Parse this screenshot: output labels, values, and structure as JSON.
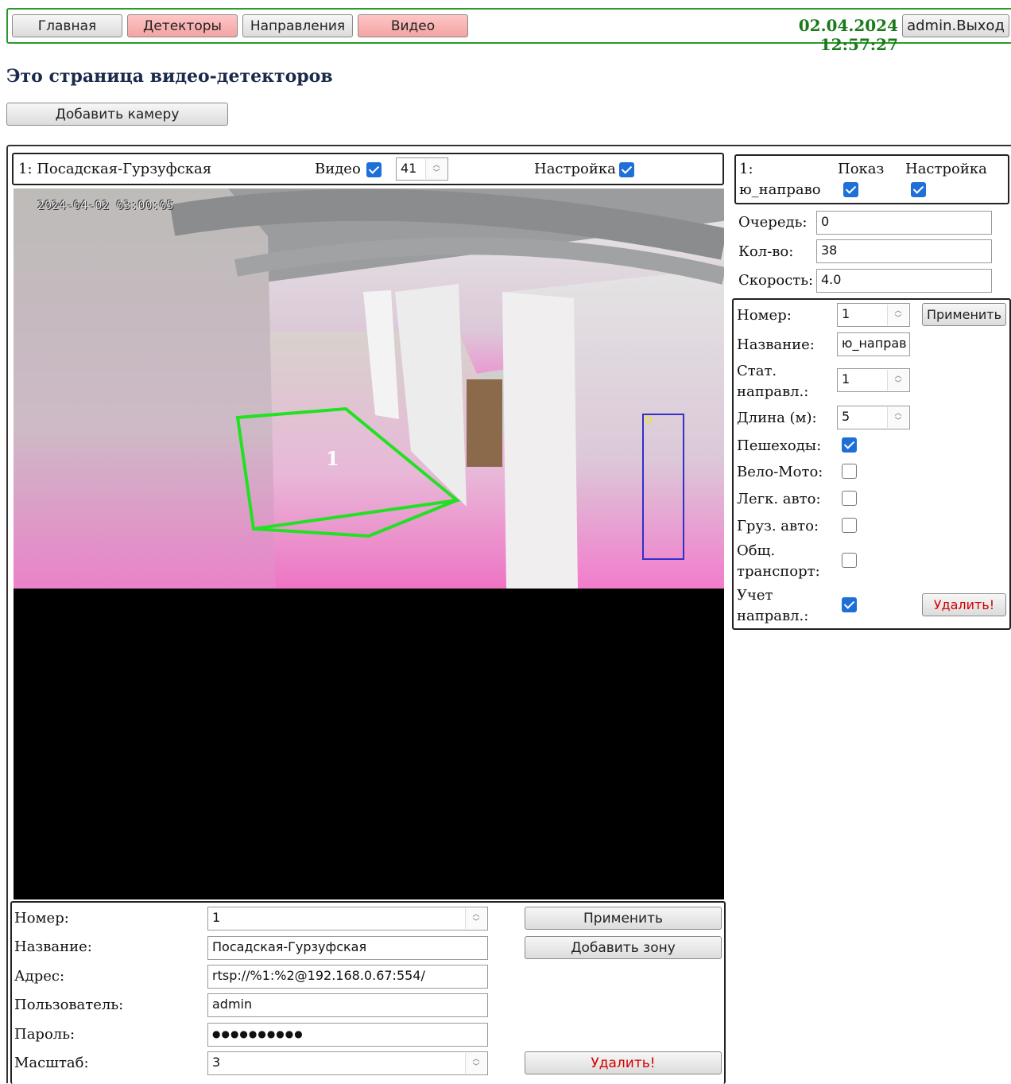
{
  "nav": {
    "home": "Главная",
    "detectors": "Детекторы",
    "directions": "Направления",
    "video": "Видео",
    "datetime": "02.04.2024 12:57:27",
    "logout": "admin.Выход"
  },
  "page_title": "Это страница видео-детекторов",
  "add_camera": "Добавить камеру",
  "camera_header": {
    "name": "1: Посадская-Гурзуфская",
    "video_label": "Видео",
    "video_checked": true,
    "fps_value": "41",
    "settings_label": "Настройка",
    "settings_checked": true
  },
  "video": {
    "timestamp": "2024-04-02 03:00:05",
    "zone_label": "1",
    "detection_label": "0",
    "zone_color": "#22e022",
    "box_color": "#3030c8"
  },
  "camera_form": {
    "number_label": "Номер:",
    "number_value": "1",
    "name_label": "Название:",
    "name_value": "Посадская-Гурзуфская",
    "address_label": "Адрес:",
    "address_value": "rtsp://%1:%2@192.168.0.67:554/",
    "user_label": "Пользователь:",
    "user_value": "admin",
    "password_label": "Пароль:",
    "password_value": "●●●●●●●●●●",
    "scale_label": "Масштаб:",
    "scale_value": "3",
    "apply": "Применить",
    "add_zone": "Добавить зону",
    "delete": "Удалить!"
  },
  "direction_header": {
    "id_line1": "1:",
    "id_line2": "ю_направо",
    "show_label": "Показ",
    "show_checked": true,
    "settings_label": "Настройка",
    "settings_checked": true
  },
  "stats": {
    "queue_label": "Очередь:",
    "queue_value": "0",
    "count_label": "Кол-во:",
    "count_value": "38",
    "speed_label": "Скорость:",
    "speed_value": "4.0"
  },
  "direction_form": {
    "number_label": "Номер:",
    "number_value": "1",
    "apply": "Применить",
    "name_label": "Название:",
    "name_value": "ю_направ",
    "stat_label_1": "Стат.",
    "stat_label_2": "направл.:",
    "stat_value": "1",
    "length_label": "Длина (м):",
    "length_value": "5",
    "pedestrians_label": "Пешеходы:",
    "pedestrians_checked": true,
    "bike_label": "Вело-Мото:",
    "bike_checked": false,
    "car_label": "Легк. авто:",
    "car_checked": false,
    "truck_label": "Груз. авто:",
    "truck_checked": false,
    "public_label_1": "Общ.",
    "public_label_2": "транспорт:",
    "public_checked": false,
    "account_label_1": "Учет",
    "account_label_2": "направл.:",
    "account_checked": true,
    "delete": "Удалить!"
  },
  "colors": {
    "nav_border": "#2a9a2a",
    "datetime": "#1a7a1a",
    "pink_button": "#f4a3a3",
    "checkbox": "#1f6fd9",
    "delete_text": "#d40000"
  }
}
